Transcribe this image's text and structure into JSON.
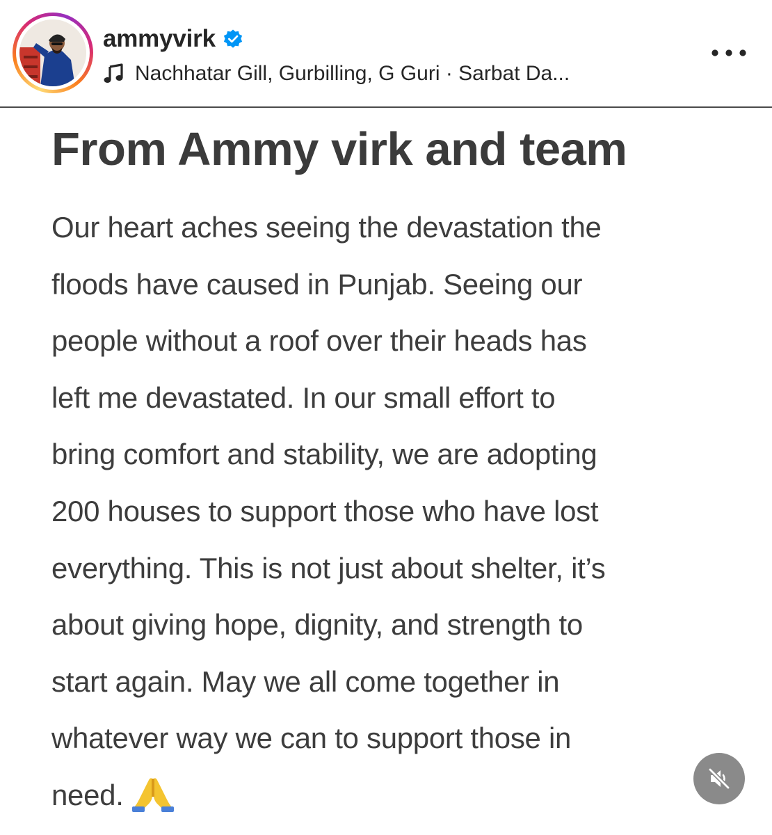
{
  "post_header": {
    "username": "ammyvirk",
    "verified": true,
    "music_text": "Nachhatar Gill, Gurbilling, G Guri · Sarbat Da...",
    "more_label": "•••"
  },
  "post": {
    "title": "From Ammy virk and team",
    "body_lines": [
      "Our heart aches seeing the devastation the",
      "floods have caused in Punjab. Seeing our",
      "people without a roof over their heads has",
      "left me devastated. In our small effort to",
      "bring comfort and stability, we are adopting",
      "200 houses to support those who have lost",
      "everything. This is not just about shelter, it’s",
      "about giving hope, dignity, and strength to",
      "start again. May we all come together in",
      "whatever way we can to support those in",
      "need."
    ],
    "emoji": "folded-hands-icon"
  },
  "controls": {
    "audio_state": "muted"
  },
  "colors": {
    "verified_blue": "#0095f6",
    "story_ring": [
      "#feda75",
      "#fa7e1e",
      "#d62976",
      "#962fbf"
    ],
    "mute_button_bg": "#8a8a8a"
  }
}
